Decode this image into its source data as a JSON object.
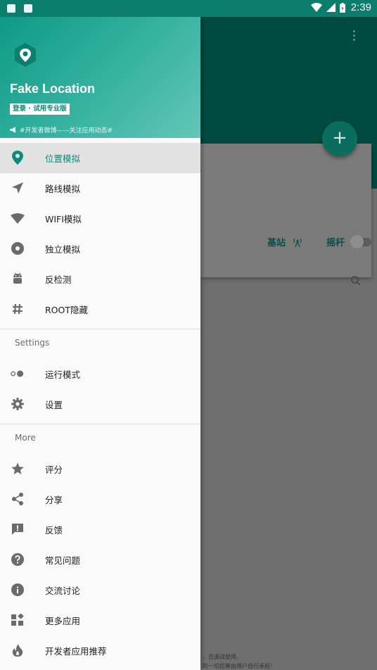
{
  "status_bar": {
    "time": "2:39"
  },
  "background": {
    "basestation_label": "基站",
    "joystick_label": "摇杆",
    "fab_symbol": "+",
    "note_line1": "，员调试使用，",
    "note_line2": "的一切后果由用户自行承担！"
  },
  "drawer": {
    "app_name": "Fake Location",
    "login_badge": "登录 · 试用专业版",
    "dev_tip": "#开发者微博——关注应用动态#",
    "primary_items": [
      {
        "label": "位置模拟",
        "icon": "location-pin-icon",
        "active": true
      },
      {
        "label": "路线模拟",
        "icon": "navigation-arrow-icon",
        "active": false
      },
      {
        "label": "WIFI模拟",
        "icon": "wifi-icon",
        "active": false
      },
      {
        "label": "独立模拟",
        "icon": "disc-icon",
        "active": false
      },
      {
        "label": "反检测",
        "icon": "android-icon",
        "active": false
      },
      {
        "label": "ROOT隐藏",
        "icon": "hash-icon",
        "active": false
      }
    ],
    "settings_header": "Settings",
    "settings_items": [
      {
        "label": "运行模式",
        "icon": "toggle-dots-icon"
      },
      {
        "label": "设置",
        "icon": "gear-icon"
      }
    ],
    "more_header": "More",
    "more_items": [
      {
        "label": "评分",
        "icon": "star-icon"
      },
      {
        "label": "分享",
        "icon": "share-icon"
      },
      {
        "label": "反馈",
        "icon": "feedback-icon"
      },
      {
        "label": "常见问题",
        "icon": "help-icon"
      },
      {
        "label": "交流讨论",
        "icon": "info-icon"
      },
      {
        "label": "更多应用",
        "icon": "widgets-icon"
      },
      {
        "label": "开发者应用推荐",
        "icon": "flame-icon"
      }
    ]
  },
  "colors": {
    "accent": "#0e8a78",
    "header_gradient_start": "#0d9a86",
    "status_bar": "#0b7d6d"
  }
}
